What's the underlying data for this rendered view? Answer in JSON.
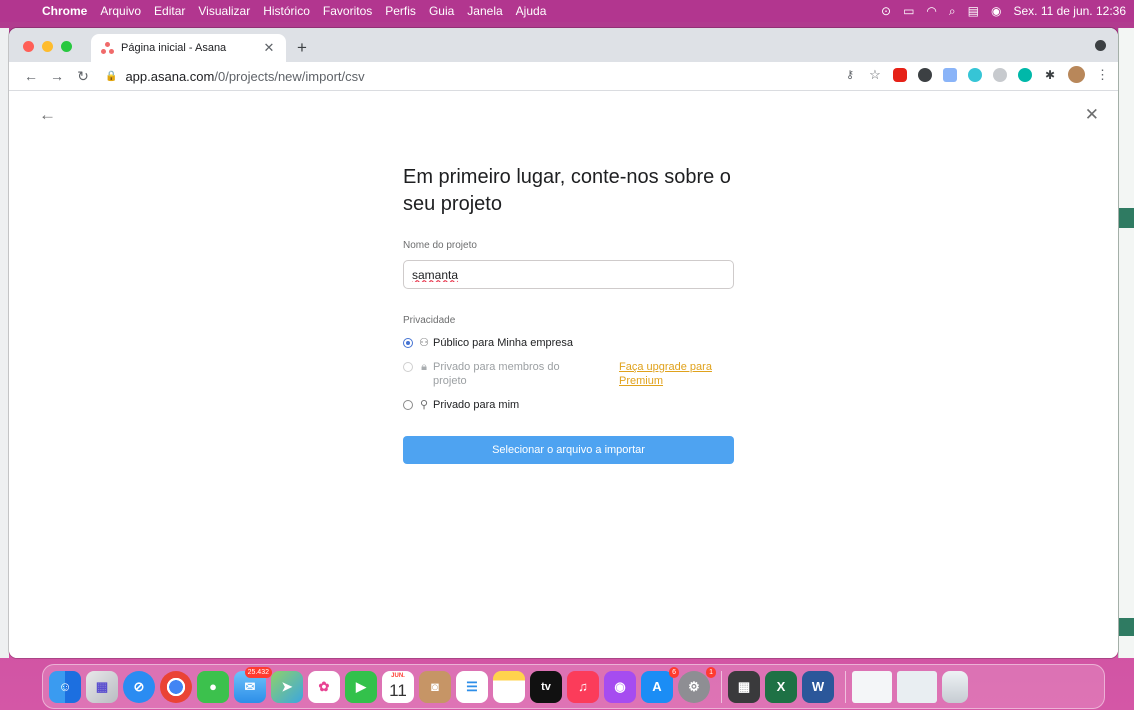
{
  "menubar": {
    "app": "Chrome",
    "items": [
      "Arquivo",
      "Editar",
      "Visualizar",
      "Histórico",
      "Favoritos",
      "Perfis",
      "Guia",
      "Janela",
      "Ajuda"
    ],
    "clock": "Sex. 11 de jun.  12:36"
  },
  "browser": {
    "tab_title": "Página inicial - Asana",
    "url_host": "app.asana.com",
    "url_path": "/0/projects/new/import/csv"
  },
  "page": {
    "heading": "Em primeiro lugar, conte-nos sobre o seu projeto",
    "name_label": "Nome do projeto",
    "name_value": "samanta",
    "privacy_label": "Privacidade",
    "option_public": "Público para Minha empresa",
    "option_members": "Privado para membros do projeto",
    "upgrade_link": "Faça upgrade para Premium",
    "option_me": "Privado para mim",
    "import_button": "Selecionar o arquivo a importar"
  },
  "dock": {
    "mail_badge": "25.432",
    "calendar_month": "JUN.",
    "calendar_day": "11",
    "appletv_label": "tv",
    "appstore_badge": "6",
    "settings_badge": "1",
    "excel_letter": "X",
    "word_letter": "W"
  }
}
